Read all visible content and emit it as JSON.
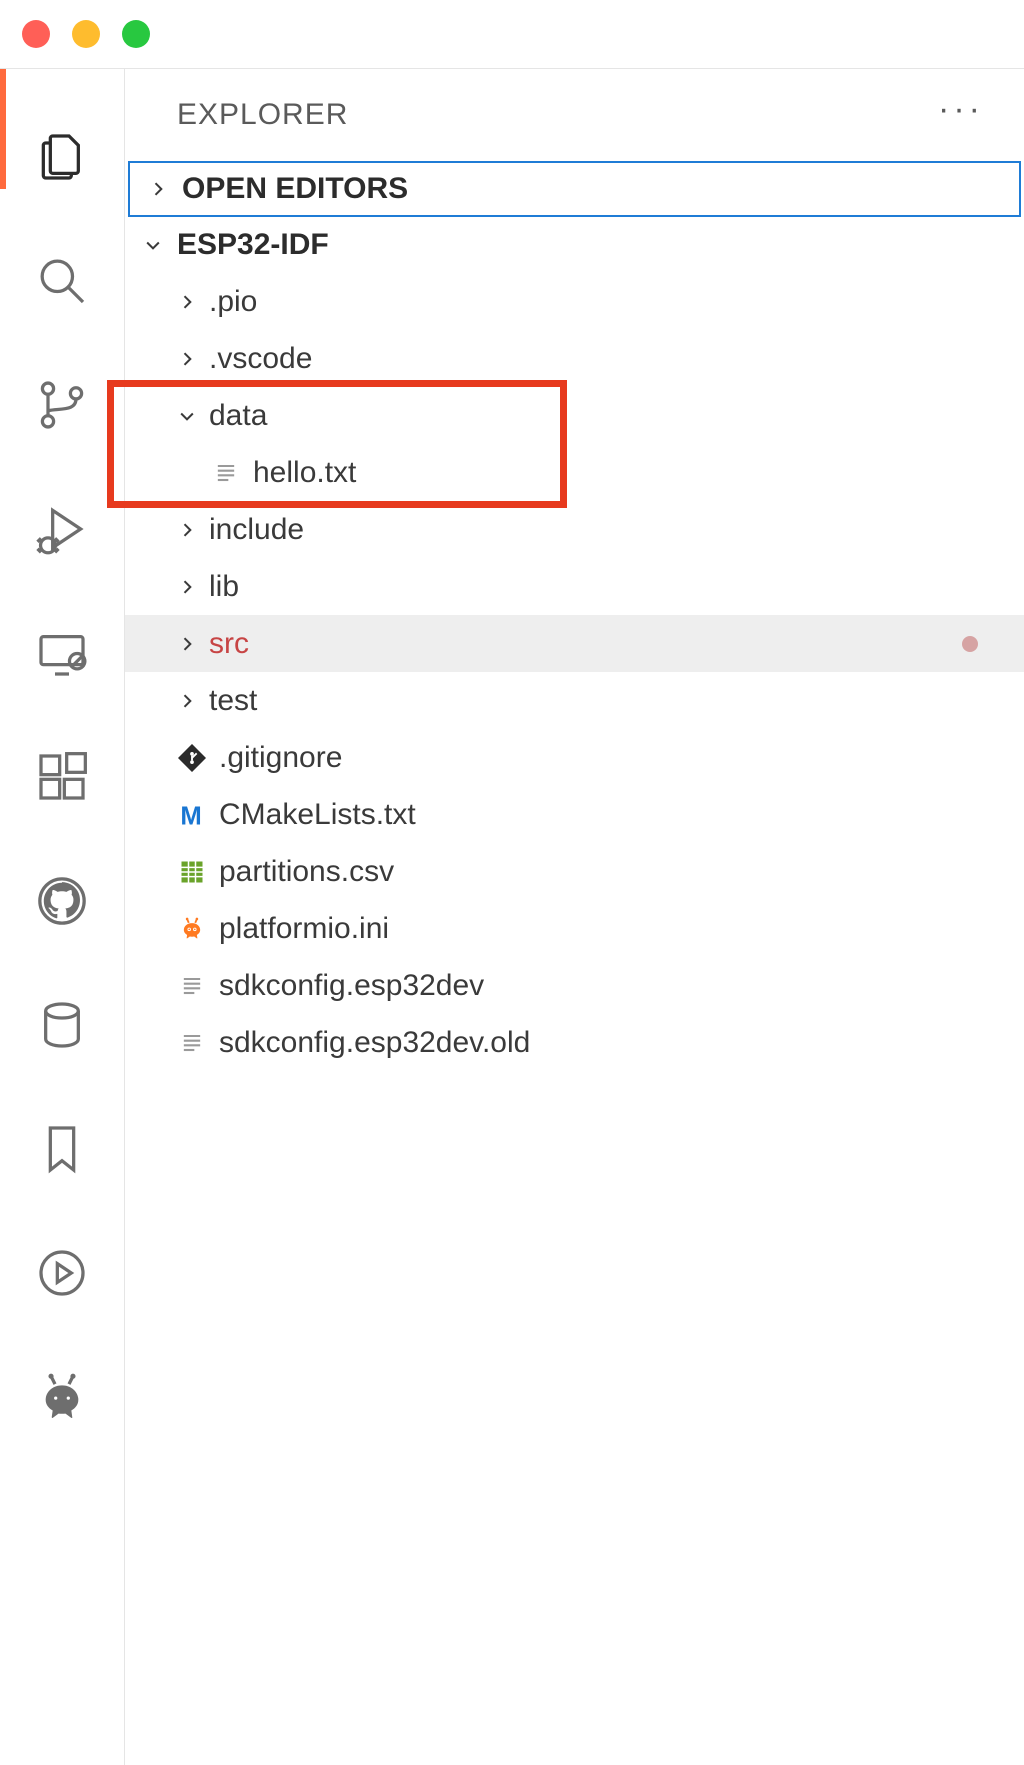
{
  "titlebar": {},
  "activitybar": {
    "items": [
      {
        "name": "explorer"
      },
      {
        "name": "search"
      },
      {
        "name": "source-control"
      },
      {
        "name": "run-debug"
      },
      {
        "name": "remote"
      },
      {
        "name": "extensions"
      },
      {
        "name": "github"
      },
      {
        "name": "database"
      },
      {
        "name": "bookmarks"
      },
      {
        "name": "play"
      },
      {
        "name": "platformio"
      }
    ]
  },
  "explorer": {
    "title": "EXPLORER"
  },
  "open_editors": {
    "label": "OPEN EDITORS"
  },
  "workspace": {
    "name": "ESP32-IDF"
  },
  "tree": {
    "rows": [
      {
        "label": ".pio"
      },
      {
        "label": ".vscode"
      },
      {
        "label": "data"
      },
      {
        "label": "hello.txt"
      },
      {
        "label": "include"
      },
      {
        "label": "lib"
      },
      {
        "label": "src"
      },
      {
        "label": "test"
      },
      {
        "label": ".gitignore"
      },
      {
        "label": "CMakeLists.txt"
      },
      {
        "label": "partitions.csv"
      },
      {
        "label": "platformio.ini"
      },
      {
        "label": "sdkconfig.esp32dev"
      },
      {
        "label": "sdkconfig.esp32dev.old"
      }
    ]
  }
}
